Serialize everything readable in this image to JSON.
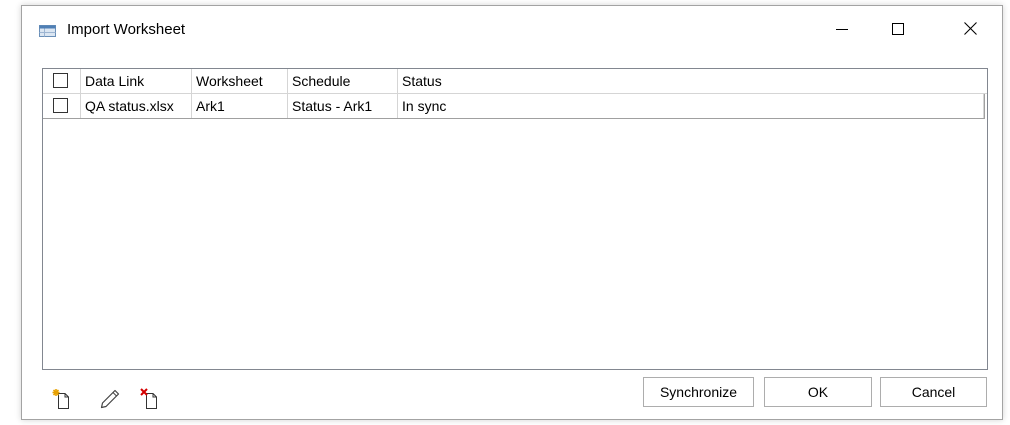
{
  "window": {
    "title": "Import Worksheet",
    "icon": "worksheet-icon"
  },
  "controls": {
    "minimize_icon": "minimize-icon",
    "maximize_icon": "maximize-icon",
    "close_icon": "close-icon"
  },
  "grid": {
    "columns": [
      "Data Link",
      "Worksheet",
      "Schedule",
      "Status"
    ],
    "rows": [
      {
        "checked": false,
        "data_link": "QA status.xlsx",
        "worksheet": "Ark1",
        "schedule": "Status - Ark1",
        "status": "In sync"
      }
    ],
    "header_checked": false
  },
  "toolbar": {
    "icons": [
      "new-link-icon",
      "edit-link-icon",
      "delete-link-icon"
    ]
  },
  "buttons": {
    "synchronize": "Synchronize",
    "ok": "OK",
    "cancel": "Cancel"
  }
}
